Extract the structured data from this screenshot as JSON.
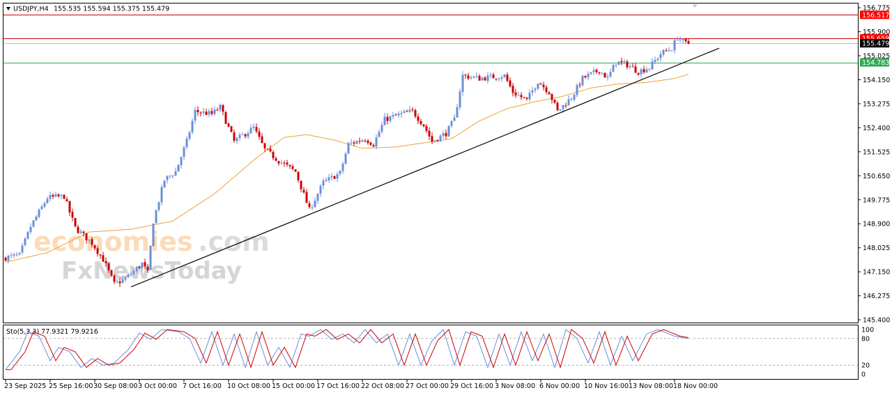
{
  "header": {
    "symbol": "USDJPY,H4",
    "ohlc": "155.535 155.594 155.375 155.479",
    "collapse_icon": "triangle-down-icon"
  },
  "watermark": {
    "line1_main": "economies",
    "line1_suffix": ".com",
    "line2": "FxNewsToday",
    "line2_parts": [
      "F",
      "x",
      "News",
      "Today"
    ]
  },
  "price_axis": {
    "ticks": [
      "156.775",
      "155.900",
      "155.025",
      "154.150",
      "153.275",
      "152.400",
      "151.525",
      "150.650",
      "149.775",
      "148.900",
      "148.025",
      "147.150",
      "146.275",
      "145.400"
    ],
    "tick_values": [
      156.775,
      155.9,
      155.025,
      154.15,
      153.275,
      152.4,
      151.525,
      150.65,
      149.775,
      148.9,
      148.025,
      147.15,
      146.275,
      145.4
    ],
    "ylim": [
      145.3,
      156.93
    ]
  },
  "levels": [
    {
      "label": "156.517",
      "value": 156.517,
      "color": "#ff0000",
      "line_color": "#cc0000"
    },
    {
      "label": "155.659",
      "value": 155.659,
      "color": "#ff0000",
      "line_color": "#cc0000"
    },
    {
      "label": "155.479",
      "value": 155.479,
      "color": "#000000",
      "line_color": "#c0c0c0"
    },
    {
      "label": "154.783",
      "value": 154.783,
      "color": "#33aa55",
      "line_color": "#33aa55"
    }
  ],
  "stochastic": {
    "label": "Sto(5,3,3) 77.9321 79.9216",
    "levels": [
      "100",
      "80",
      "20",
      "0"
    ],
    "level_values": [
      100,
      80,
      20,
      0
    ],
    "main_color": "#6a8fd8",
    "signal_color": "#cc0000"
  },
  "time_axis": {
    "labels": [
      "23 Sep 2025",
      "25 Sep 16:00",
      "30 Sep 08:00",
      "3 Oct 00:00",
      "7 Oct 16:00",
      "10 Oct 08:00",
      "15 Oct 00:00",
      "17 Oct 16:00",
      "22 Oct 08:00",
      "27 Oct 00:00",
      "29 Oct 16:00",
      "3 Nov 08:00",
      "6 Nov 00:00",
      "10 Nov 16:00",
      "13 Nov 08:00",
      "18 Nov 00:00"
    ],
    "label_bars": [
      0,
      16,
      32,
      48,
      64,
      80,
      96,
      112,
      128,
      144,
      160,
      176,
      192,
      208,
      224,
      240
    ]
  },
  "colors": {
    "bull": "#6a8fd8",
    "bear": "#cc0000",
    "ma": "#f0a030",
    "trendline": "#000000",
    "frame": "#000000",
    "grid_dots": "#b0b0b0"
  },
  "chart_data": {
    "type": "candlestick",
    "title": "USDJPY,H4",
    "xlabel": "",
    "ylabel": "",
    "bar_count": 246,
    "anchors": [
      {
        "bar": 0,
        "price": 147.65
      },
      {
        "bar": 6,
        "price": 147.75
      },
      {
        "bar": 10,
        "price": 148.8
      },
      {
        "bar": 16,
        "price": 149.85
      },
      {
        "bar": 22,
        "price": 149.9
      },
      {
        "bar": 26,
        "price": 148.75
      },
      {
        "bar": 32,
        "price": 148.2
      },
      {
        "bar": 36,
        "price": 147.6
      },
      {
        "bar": 40,
        "price": 146.7
      },
      {
        "bar": 44,
        "price": 146.9
      },
      {
        "bar": 50,
        "price": 147.45
      },
      {
        "bar": 52,
        "price": 147.1
      },
      {
        "bar": 54,
        "price": 149.0
      },
      {
        "bar": 58,
        "price": 150.5
      },
      {
        "bar": 62,
        "price": 150.8
      },
      {
        "bar": 66,
        "price": 151.9
      },
      {
        "bar": 69,
        "price": 153.0
      },
      {
        "bar": 75,
        "price": 152.9
      },
      {
        "bar": 78,
        "price": 153.15
      },
      {
        "bar": 83,
        "price": 151.9
      },
      {
        "bar": 90,
        "price": 152.4
      },
      {
        "bar": 94,
        "price": 151.6
      },
      {
        "bar": 99,
        "price": 151.2
      },
      {
        "bar": 105,
        "price": 150.8
      },
      {
        "bar": 110,
        "price": 149.4
      },
      {
        "bar": 115,
        "price": 150.4
      },
      {
        "bar": 121,
        "price": 150.75
      },
      {
        "bar": 124,
        "price": 151.8
      },
      {
        "bar": 130,
        "price": 152.0
      },
      {
        "bar": 133,
        "price": 151.8
      },
      {
        "bar": 137,
        "price": 152.7
      },
      {
        "bar": 143,
        "price": 152.9
      },
      {
        "bar": 147,
        "price": 153.0
      },
      {
        "bar": 151,
        "price": 152.5
      },
      {
        "bar": 154,
        "price": 151.9
      },
      {
        "bar": 159,
        "price": 152.2
      },
      {
        "bar": 162,
        "price": 152.7
      },
      {
        "bar": 165,
        "price": 154.3
      },
      {
        "bar": 171,
        "price": 154.2
      },
      {
        "bar": 180,
        "price": 154.3
      },
      {
        "bar": 183,
        "price": 153.7
      },
      {
        "bar": 188,
        "price": 153.4
      },
      {
        "bar": 192,
        "price": 154.1
      },
      {
        "bar": 196,
        "price": 153.7
      },
      {
        "bar": 199,
        "price": 153.0
      },
      {
        "bar": 204,
        "price": 153.5
      },
      {
        "bar": 208,
        "price": 154.2
      },
      {
        "bar": 214,
        "price": 154.5
      },
      {
        "bar": 217,
        "price": 154.2
      },
      {
        "bar": 220,
        "price": 154.8
      },
      {
        "bar": 224,
        "price": 154.7
      },
      {
        "bar": 228,
        "price": 154.45
      },
      {
        "bar": 232,
        "price": 154.6
      },
      {
        "bar": 236,
        "price": 155.1
      },
      {
        "bar": 240,
        "price": 155.3
      },
      {
        "bar": 242,
        "price": 155.7
      },
      {
        "bar": 245,
        "price": 155.48
      }
    ],
    "moving_average": [
      {
        "bar": 0,
        "price": 147.5
      },
      {
        "bar": 15,
        "price": 147.85
      },
      {
        "bar": 30,
        "price": 148.6
      },
      {
        "bar": 45,
        "price": 148.7
      },
      {
        "bar": 60,
        "price": 149.0
      },
      {
        "bar": 75,
        "price": 150.0
      },
      {
        "bar": 90,
        "price": 151.3
      },
      {
        "bar": 100,
        "price": 152.05
      },
      {
        "bar": 108,
        "price": 152.15
      },
      {
        "bar": 118,
        "price": 151.95
      },
      {
        "bar": 128,
        "price": 151.65
      },
      {
        "bar": 140,
        "price": 151.7
      },
      {
        "bar": 150,
        "price": 151.85
      },
      {
        "bar": 160,
        "price": 152.0
      },
      {
        "bar": 170,
        "price": 152.65
      },
      {
        "bar": 180,
        "price": 153.1
      },
      {
        "bar": 190,
        "price": 153.35
      },
      {
        "bar": 200,
        "price": 153.55
      },
      {
        "bar": 210,
        "price": 153.85
      },
      {
        "bar": 220,
        "price": 154.0
      },
      {
        "bar": 230,
        "price": 154.05
      },
      {
        "bar": 240,
        "price": 154.2
      },
      {
        "bar": 245,
        "price": 154.35
      }
    ],
    "trendline": [
      {
        "bar": 45,
        "price": 146.6
      },
      {
        "bar": 256,
        "price": 155.3
      }
    ],
    "stochastic_main": [
      {
        "bar": 0,
        "value": 10
      },
      {
        "bar": 5,
        "value": 50
      },
      {
        "bar": 8,
        "value": 95
      },
      {
        "bar": 12,
        "value": 85
      },
      {
        "bar": 16,
        "value": 30
      },
      {
        "bar": 19,
        "value": 60
      },
      {
        "bar": 23,
        "value": 50
      },
      {
        "bar": 27,
        "value": 15
      },
      {
        "bar": 31,
        "value": 35
      },
      {
        "bar": 35,
        "value": 20
      },
      {
        "bar": 39,
        "value": 25
      },
      {
        "bar": 44,
        "value": 55
      },
      {
        "bar": 48,
        "value": 92
      },
      {
        "bar": 52,
        "value": 78
      },
      {
        "bar": 56,
        "value": 100
      },
      {
        "bar": 62,
        "value": 95
      },
      {
        "bar": 66,
        "value": 80
      },
      {
        "bar": 70,
        "value": 25
      },
      {
        "bar": 74,
        "value": 95
      },
      {
        "bar": 78,
        "value": 20
      },
      {
        "bar": 82,
        "value": 90
      },
      {
        "bar": 86,
        "value": 15
      },
      {
        "bar": 90,
        "value": 95
      },
      {
        "bar": 94,
        "value": 20
      },
      {
        "bar": 98,
        "value": 60
      },
      {
        "bar": 102,
        "value": 15
      },
      {
        "bar": 106,
        "value": 90
      },
      {
        "bar": 109,
        "value": 85
      },
      {
        "bar": 113,
        "value": 100
      },
      {
        "bar": 117,
        "value": 78
      },
      {
        "bar": 121,
        "value": 90
      },
      {
        "bar": 125,
        "value": 70
      },
      {
        "bar": 129,
        "value": 100
      },
      {
        "bar": 133,
        "value": 70
      },
      {
        "bar": 137,
        "value": 90
      },
      {
        "bar": 141,
        "value": 20
      },
      {
        "bar": 145,
        "value": 90
      },
      {
        "bar": 149,
        "value": 20
      },
      {
        "bar": 153,
        "value": 75
      },
      {
        "bar": 157,
        "value": 100
      },
      {
        "bar": 161,
        "value": 20
      },
      {
        "bar": 165,
        "value": 95
      },
      {
        "bar": 169,
        "value": 85
      },
      {
        "bar": 173,
        "value": 15
      },
      {
        "bar": 177,
        "value": 90
      },
      {
        "bar": 181,
        "value": 20
      },
      {
        "bar": 185,
        "value": 95
      },
      {
        "bar": 189,
        "value": 30
      },
      {
        "bar": 193,
        "value": 90
      },
      {
        "bar": 197,
        "value": 15
      },
      {
        "bar": 201,
        "value": 100
      },
      {
        "bar": 205,
        "value": 80
      },
      {
        "bar": 209,
        "value": 25
      },
      {
        "bar": 213,
        "value": 95
      },
      {
        "bar": 217,
        "value": 20
      },
      {
        "bar": 221,
        "value": 85
      },
      {
        "bar": 225,
        "value": 30
      },
      {
        "bar": 230,
        "value": 90
      },
      {
        "bar": 234,
        "value": 100
      },
      {
        "bar": 240,
        "value": 85
      },
      {
        "bar": 245,
        "value": 80
      }
    ],
    "stochastic_signal_lag_bars": 2
  }
}
